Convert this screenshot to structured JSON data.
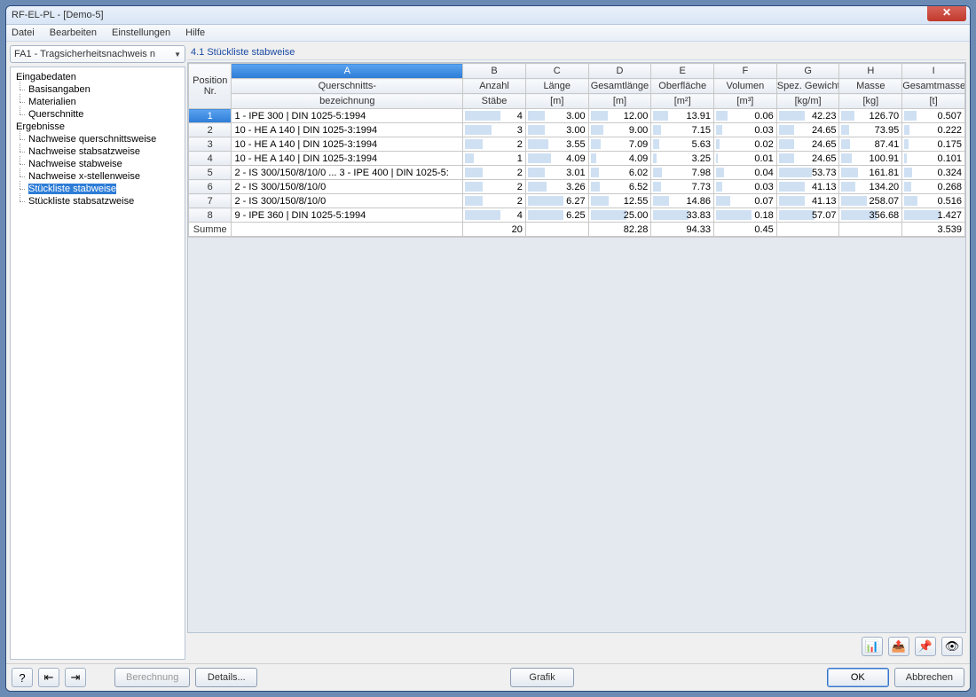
{
  "window": {
    "title": "RF-EL-PL - [Demo-5]"
  },
  "menu": [
    "Datei",
    "Bearbeiten",
    "Einstellungen",
    "Hilfe"
  ],
  "combo": {
    "text": "FA1 - Tragsicherheitsnachweis n"
  },
  "tree": {
    "section_input": "Eingabedaten",
    "input_items": [
      "Basisangaben",
      "Materialien",
      "Querschnitte"
    ],
    "section_results": "Ergebnisse",
    "result_items": [
      "Nachweise querschnittsweise",
      "Nachweise stabsatzweise",
      "Nachweise stabweise",
      "Nachweise x-stellenweise",
      "Stückliste stabweise",
      "Stückliste stabsatzweise"
    ],
    "selected_index": 4
  },
  "section_title": "4.1 Stückliste stabweise",
  "table": {
    "col_letters": [
      "A",
      "B",
      "C",
      "D",
      "E",
      "F",
      "G",
      "H",
      "I"
    ],
    "header1": [
      "Position",
      "Querschnitts-",
      "Anzahl",
      "Länge",
      "Gesamtlänge",
      "Oberfläche",
      "Volumen",
      "Spez. Gewicht",
      "Masse",
      "Gesamtmasse"
    ],
    "header2": [
      "Nr.",
      "bezeichnung",
      "Stäbe",
      "[m]",
      "[m]",
      "[m²]",
      "[m³]",
      "[kg/m]",
      "[kg]",
      "[t]"
    ],
    "rows": [
      {
        "n": "1",
        "a": "1 - IPE 300 | DIN 1025-5:1994",
        "b": "4",
        "c": "3.00",
        "d": "12.00",
        "e": "13.91",
        "f": "0.06",
        "g": "42.23",
        "h": "126.70",
        "i": "0.507"
      },
      {
        "n": "2",
        "a": "10 - HE A 140 | DIN 1025-3:1994",
        "b": "3",
        "c": "3.00",
        "d": "9.00",
        "e": "7.15",
        "f": "0.03",
        "g": "24.65",
        "h": "73.95",
        "i": "0.222"
      },
      {
        "n": "3",
        "a": "10 - HE A 140 | DIN 1025-3:1994",
        "b": "2",
        "c": "3.55",
        "d": "7.09",
        "e": "5.63",
        "f": "0.02",
        "g": "24.65",
        "h": "87.41",
        "i": "0.175"
      },
      {
        "n": "4",
        "a": "10 - HE A 140 | DIN 1025-3:1994",
        "b": "1",
        "c": "4.09",
        "d": "4.09",
        "e": "3.25",
        "f": "0.01",
        "g": "24.65",
        "h": "100.91",
        "i": "0.101"
      },
      {
        "n": "5",
        "a": "2 - IS 300/150/8/10/0 ... 3 - IPE 400 | DIN 1025-5:",
        "b": "2",
        "c": "3.01",
        "d": "6.02",
        "e": "7.98",
        "f": "0.04",
        "g": "53.73",
        "h": "161.81",
        "i": "0.324"
      },
      {
        "n": "6",
        "a": "2 - IS 300/150/8/10/0",
        "b": "2",
        "c": "3.26",
        "d": "6.52",
        "e": "7.73",
        "f": "0.03",
        "g": "41.13",
        "h": "134.20",
        "i": "0.268"
      },
      {
        "n": "7",
        "a": "2 - IS 300/150/8/10/0",
        "b": "2",
        "c": "6.27",
        "d": "12.55",
        "e": "14.86",
        "f": "0.07",
        "g": "41.13",
        "h": "258.07",
        "i": "0.516"
      },
      {
        "n": "8",
        "a": "9 - IPE 360 | DIN 1025-5:1994",
        "b": "4",
        "c": "6.25",
        "d": "25.00",
        "e": "33.83",
        "f": "0.18",
        "g": "57.07",
        "h": "356.68",
        "i": "1.427"
      }
    ],
    "sum_label": "Summe",
    "sum": {
      "b": "20",
      "d": "82.28",
      "e": "94.33",
      "f": "0.45",
      "i": "3.539"
    },
    "max": {
      "b": 4,
      "c": 6.27,
      "d": 25.0,
      "e": 33.83,
      "f": 0.18,
      "g": 57.07,
      "h": 356.68,
      "i": 1.427
    }
  },
  "icon_buttons": [
    "chart-icon",
    "export-icon",
    "pin-icon",
    "eye-icon"
  ],
  "footer": {
    "help": "?",
    "nav_prev": "◄",
    "nav_next": "►",
    "berechnung": "Berechnung",
    "details": "Details...",
    "grafik": "Grafik",
    "ok": "OK",
    "abbrechen": "Abbrechen"
  }
}
